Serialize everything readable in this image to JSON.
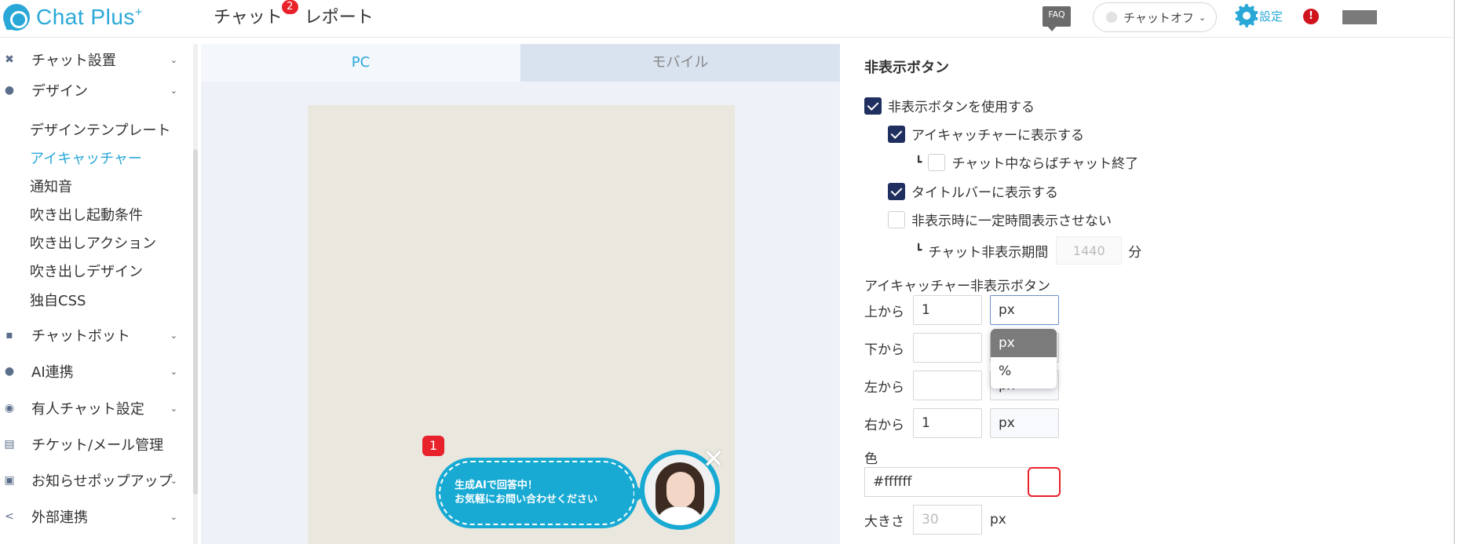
{
  "header": {
    "logo_text": "Chat Plus",
    "logo_sup": "+",
    "nav": [
      {
        "label": "チャット",
        "badge": "2"
      },
      {
        "label": "レポート",
        "badge": ""
      }
    ],
    "faq_label": "FAQ",
    "chat_status": "チャットオフ",
    "settings_label": "設定",
    "alert_label": "!"
  },
  "sidebar": {
    "sections": [
      {
        "label": "チャット設置",
        "icon": "tools-icon"
      },
      {
        "label": "デザイン",
        "icon": "palette-icon"
      },
      {
        "label": "チャットボット",
        "icon": "chat-icon"
      },
      {
        "label": "AI連携",
        "icon": "ai-icon"
      },
      {
        "label": "有人チャット設定",
        "icon": "operator-icon"
      },
      {
        "label": "チケット/メール管理",
        "icon": "ticket-icon"
      },
      {
        "label": "お知らせポップアップ",
        "icon": "popup-icon"
      },
      {
        "label": "外部連携",
        "icon": "share-icon"
      }
    ],
    "design_items": [
      "デザインテンプレート",
      "アイキャッチャー",
      "通知音",
      "吹き出し起動条件",
      "吹き出しアクション",
      "吹き出しデザイン",
      "独自CSS"
    ],
    "active_item": "アイキャッチャー"
  },
  "preview": {
    "tabs": [
      "PC",
      "モバイル"
    ],
    "active_tab": "PC",
    "bubble_badge": "1",
    "bubble_line1": "生成AIで回答中！",
    "bubble_line2": "お気軽にお問い合わせください",
    "close_label": "✕"
  },
  "panel": {
    "title": "非表示ボタン",
    "use_hide_button": {
      "label": "非表示ボタンを使用する",
      "checked": true
    },
    "show_on_eyecatcher": {
      "label": "アイキャッチャーに表示する",
      "checked": true
    },
    "end_chat_if_chatting": {
      "label": "チャット中ならばチャット終了",
      "checked": false
    },
    "show_on_titlebar": {
      "label": "タイトルバーに表示する",
      "checked": true
    },
    "no_timed_hide": {
      "label": "非表示時に一定時間表示させない",
      "checked": false
    },
    "hide_period": {
      "label": "チャット非表示期間",
      "value": "1440",
      "unit": "分"
    },
    "section_label": "アイキャッチャー非表示ボタン",
    "position": [
      {
        "label": "上から",
        "value": "1",
        "unit": "px"
      },
      {
        "label": "下から",
        "value": "",
        "unit": "px"
      },
      {
        "label": "左から",
        "value": "",
        "unit": "px"
      },
      {
        "label": "右から",
        "value": "1",
        "unit": "px"
      }
    ],
    "unit_options": [
      "px",
      "%"
    ],
    "unit_selected": "px",
    "color_label": "色",
    "color_value": "#ffffff",
    "size_label": "大きさ",
    "size_value": "30",
    "size_unit": "px"
  },
  "colors": {
    "accent": "#29a8d8",
    "checkbox": "#1f2f5f",
    "badge": "#e8222b",
    "bubble": "#18aad3"
  }
}
